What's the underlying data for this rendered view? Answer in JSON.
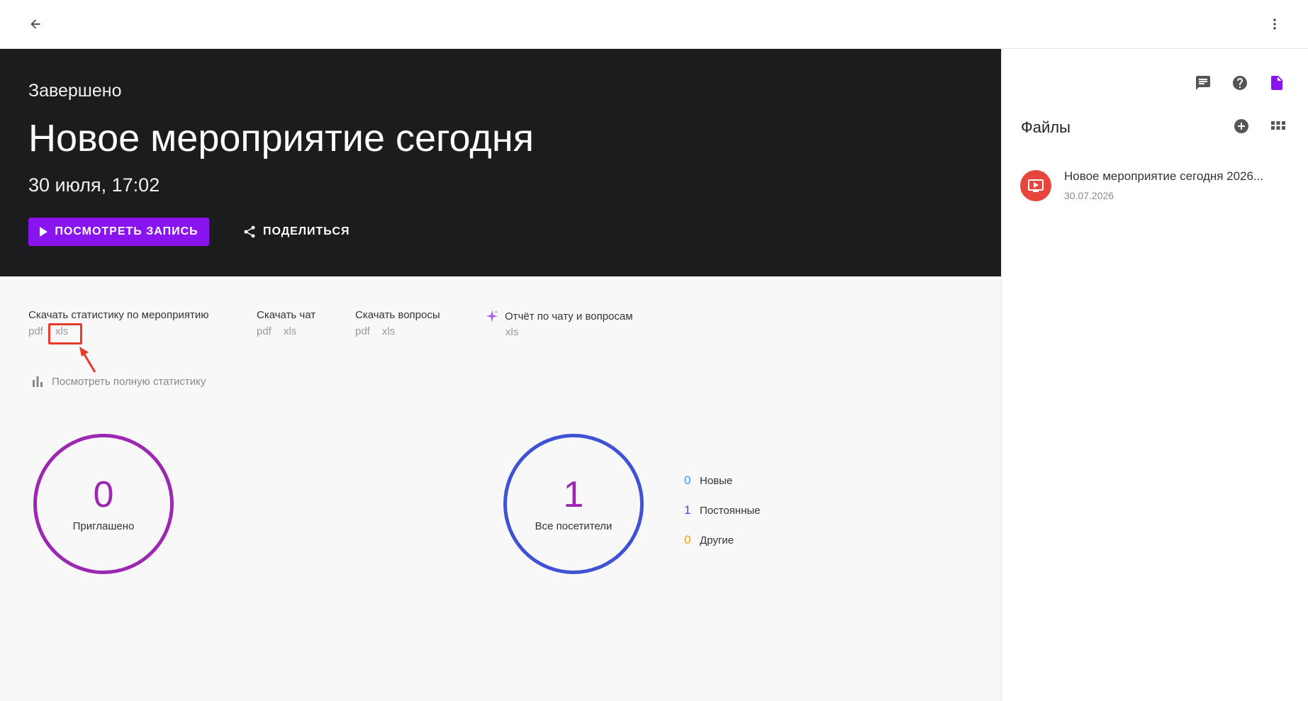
{
  "header": {
    "back_icon": "arrow-left-icon",
    "more_icon": "more-vertical-icon"
  },
  "hero": {
    "status": "Завершено",
    "title": "Новое мероприятие сегодня",
    "date": "30 июля, 17:02",
    "watch_label": "ПОСМОТРЕТЬ ЗАПИСЬ",
    "share_label": "ПОДЕЛИТЬСЯ",
    "accent_color": "#8a14f0",
    "background_color": "#1c1c1e"
  },
  "downloads": [
    {
      "title": "Скачать статистику по мероприятию",
      "links": [
        "pdf",
        "xls"
      ]
    },
    {
      "title": "Скачать чат",
      "links": [
        "pdf",
        "xls"
      ]
    },
    {
      "title": "Скачать вопросы",
      "links": [
        "pdf",
        "xls"
      ]
    },
    {
      "title": "Отчёт по чату и вопросам",
      "links": [
        "xls"
      ],
      "icon": "sparkle-icon"
    }
  ],
  "full_stats_label": "Посмотреть полную статистику",
  "stats": {
    "invited": {
      "value": "0",
      "label": "Приглашено",
      "color": "#9c27b0"
    },
    "visitors": {
      "value": "1",
      "label": "Все посетители",
      "color": "#3f51d4"
    },
    "legend": [
      {
        "value": "0",
        "label": "Новые",
        "color": "#3a9ae8"
      },
      {
        "value": "1",
        "label": "Постоянные",
        "color": "#3f51d4"
      },
      {
        "value": "0",
        "label": "Другие",
        "color": "#f0a500"
      }
    ]
  },
  "sidebar": {
    "icons": [
      "chat-icon",
      "help-icon",
      "file-icon"
    ],
    "files_title": "Файлы",
    "files": [
      {
        "name": "Новое мероприятие сегодня 2026...",
        "date": "30.07.2026"
      }
    ]
  }
}
